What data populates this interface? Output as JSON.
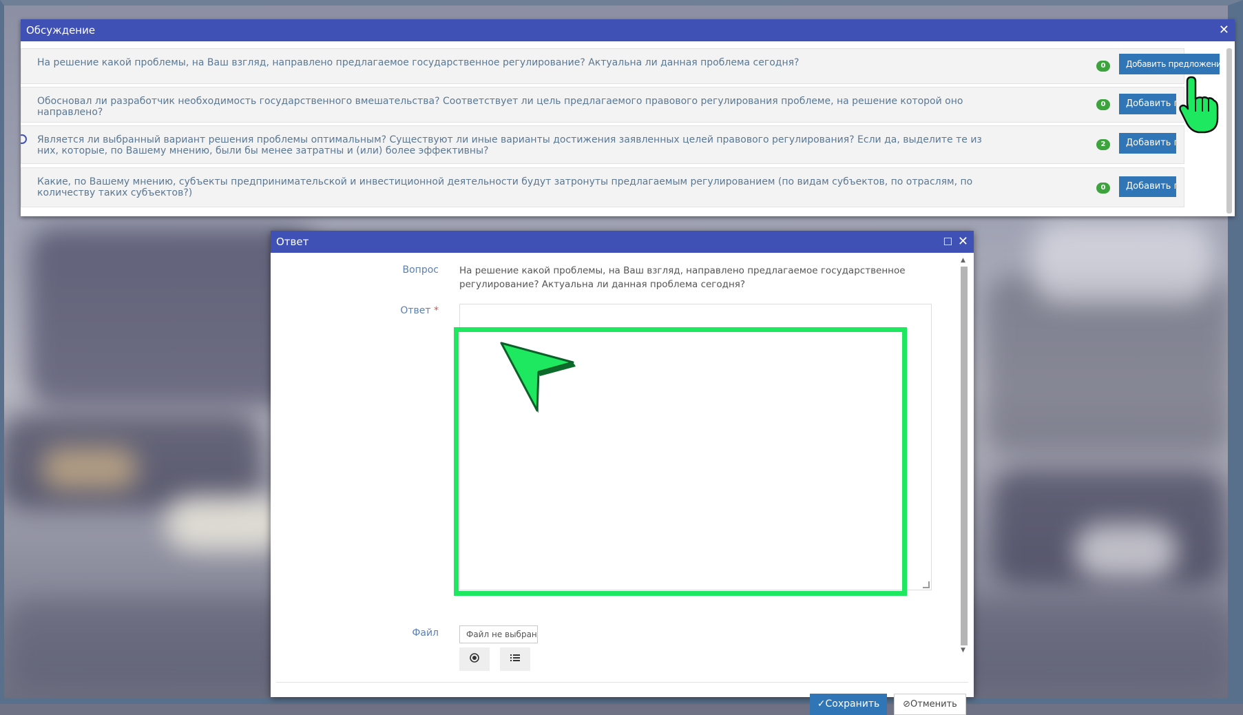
{
  "discussion": {
    "title": "Обсуждение",
    "close_glyph": "✕",
    "rows": [
      {
        "question": "На решение какой проблемы, на Ваш взгляд, направлено предлагаемое государственное регулирование? Актуальна ли данная проблема сегодня?",
        "count": "0",
        "button": "Добавить предложение"
      },
      {
        "question": "Обосновал ли разработчик необходимость государственного вмешательства? Соответствует ли цель предлагаемого правового регулирования проблеме, на решение которой оно направлено?",
        "count": "0",
        "button": "Добавить пр"
      },
      {
        "question": "Является ли выбранный вариант решения проблемы оптимальным? Существуют ли иные варианты достижения заявленных целей правового регулирования? Если да, выделите те из них, которые, по Вашему мнению, были бы менее затратны и (или) более эффективны?",
        "count": "2",
        "button": "Добавить пр"
      },
      {
        "question": "Какие, по Вашему мнению, субъекты предпринимательской и инвестиционной деятельности будут затронуты предлагаемым регулированием (по видам субъектов, по отраслям, по количеству таких субъектов?)",
        "count": "0",
        "button": "Добавить пр"
      }
    ]
  },
  "answer_dialog": {
    "title": "Ответ",
    "maximize_glyph": "☐",
    "close_glyph": "✕",
    "question_label": "Вопрос",
    "question_value": "На решение какой проблемы, на Ваш взгляд, направлено предлагаемое государственное регулирование? Актуальна ли данная проблема сегодня?",
    "answer_label": "Ответ",
    "required_mark": "*",
    "answer_value": "",
    "file_label": "Файл",
    "file_value": "Файл не выбран",
    "save_label": "Сохранить",
    "cancel_label": "Отменить",
    "highlight_color": "#1ee85f"
  },
  "icons": {
    "save": "check-icon",
    "cancel": "block-icon",
    "preview": "eye-icon",
    "list": "list-icon",
    "hand_cursor": "hand-pointer-icon",
    "arrow_cursor": "arrow-pointer-icon"
  },
  "colors": {
    "titlebar": "#3f51b5",
    "button": "#3075b5",
    "badge": "#3da33d"
  }
}
